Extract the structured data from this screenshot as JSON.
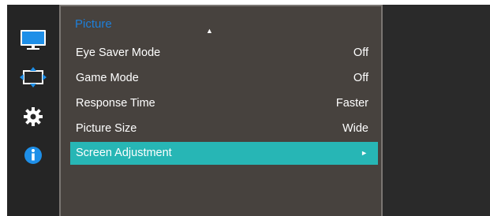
{
  "sidebar": {
    "icons": [
      {
        "name": "monitor-icon"
      },
      {
        "name": "screen-adjust-icon"
      },
      {
        "name": "gear-icon"
      },
      {
        "name": "info-icon"
      }
    ]
  },
  "menu": {
    "title": "Picture",
    "up_arrow": "▲",
    "items": [
      {
        "label": "Eye Saver Mode",
        "value": "Off"
      },
      {
        "label": "Game Mode",
        "value": "Off"
      },
      {
        "label": "Response Time",
        "value": "Faster"
      },
      {
        "label": "Picture Size",
        "value": "Wide"
      },
      {
        "label": "Screen Adjustment",
        "value": "",
        "arrow": "►",
        "selected": true
      }
    ]
  },
  "colors": {
    "selected_row": "#27b6b5",
    "title": "#1e7fd9",
    "panel_bg": "#47423e",
    "osd_bg": "#2a2a2a"
  }
}
